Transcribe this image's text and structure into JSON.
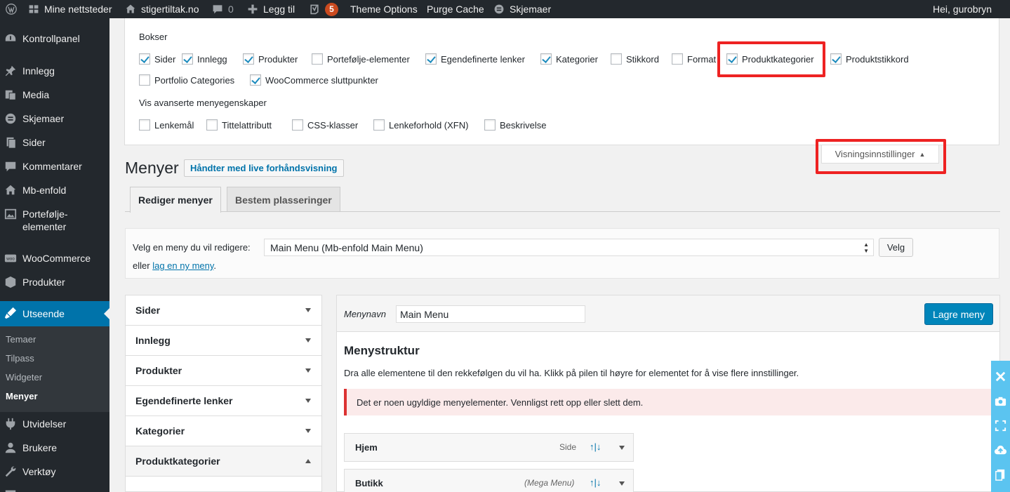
{
  "adminbar": {
    "my_sites": "Mine nettsteder",
    "site": "stigertiltak.no",
    "comments": "0",
    "new": "Legg til",
    "yoast_count": "5",
    "theme_options": "Theme Options",
    "purge_cache": "Purge Cache",
    "forms": "Skjemaer",
    "greeting": "Hei, gurobryn"
  },
  "sidebar": {
    "items": [
      {
        "label": "Kontrollpanel",
        "icon": "dashboard-icon"
      },
      {
        "label": "Innlegg",
        "icon": "pin-icon"
      },
      {
        "label": "Media",
        "icon": "media-icon"
      },
      {
        "label": "Skjemaer",
        "icon": "forms-icon"
      },
      {
        "label": "Sider",
        "icon": "pages-icon"
      },
      {
        "label": "Kommentarer",
        "icon": "comment-icon"
      },
      {
        "label": "Mb-enfold",
        "icon": "home-icon"
      },
      {
        "label": "Portefølje-elementer",
        "icon": "portfolio-icon"
      },
      {
        "label": "WooCommerce",
        "icon": "woo-icon"
      },
      {
        "label": "Produkter",
        "icon": "products-icon"
      },
      {
        "label": "Utseende",
        "icon": "appearance-icon"
      },
      {
        "label": "Utvidelser",
        "icon": "plugins-icon"
      },
      {
        "label": "Brukere",
        "icon": "users-icon"
      },
      {
        "label": "Verktøy",
        "icon": "tools-icon"
      }
    ],
    "sub": [
      "Temaer",
      "Tilpass",
      "Widgeter",
      "Menyer"
    ]
  },
  "screen_options": {
    "boxes_title": "Bokser",
    "boxes": [
      {
        "label": "Sider",
        "checked": true
      },
      {
        "label": "Innlegg",
        "checked": true
      },
      {
        "label": "Produkter",
        "checked": true
      },
      {
        "label": "Portefølje-elementer",
        "checked": false
      },
      {
        "label": "Egendefinerte lenker",
        "checked": true
      },
      {
        "label": "Kategorier",
        "checked": true
      },
      {
        "label": "Stikkord",
        "checked": false
      },
      {
        "label": "Format",
        "checked": false
      },
      {
        "label": "Produktkategorier",
        "checked": true
      },
      {
        "label": "Produktstikkord",
        "checked": true
      },
      {
        "label": "Portfolio Categories",
        "checked": false
      },
      {
        "label": "WooCommerce sluttpunkter",
        "checked": true
      }
    ],
    "advanced_title": "Vis avanserte menyegenskaper",
    "advanced": [
      {
        "label": "Lenkemål",
        "checked": false
      },
      {
        "label": "Tittelattributt",
        "checked": false
      },
      {
        "label": "CSS-klasser",
        "checked": false
      },
      {
        "label": "Lenkeforhold (XFN)",
        "checked": false
      },
      {
        "label": "Beskrivelse",
        "checked": false
      }
    ],
    "toggle_label": "Visningsinnstillinger"
  },
  "page": {
    "title": "Menyer",
    "live_button": "Håndter med live forhåndsvisning",
    "tabs": [
      "Rediger menyer",
      "Bestem plasseringer"
    ]
  },
  "manage": {
    "label": "Velg en meny du vil redigere:",
    "selected": "Main Menu (Mb-enfold Main Menu)",
    "select_button": "Velg",
    "or_text": "eller",
    "create_link": "lag en ny meny",
    "period": "."
  },
  "accordion": [
    "Sider",
    "Innlegg",
    "Produkter",
    "Egendefinerte lenker",
    "Kategorier",
    "Produktkategorier"
  ],
  "editor": {
    "name_label": "Menynavn",
    "name_value": "Main Menu",
    "save_button": "Lagre meny",
    "structure_title": "Menystruktur",
    "structure_desc": "Dra alle elementene til den rekkefølgen du vil ha. Klikk på pilen til høyre for elementet for å vise flere innstillinger.",
    "error": "Det er noen ugyldige menyelementer. Vennligst rett opp eller slett dem.",
    "items": [
      {
        "title": "Hjem",
        "type": "Side",
        "updown": "↑|↓"
      },
      {
        "title": "Butikk",
        "type": "(Mega Menu)",
        "updown": "↑|↓"
      }
    ]
  },
  "colors": {
    "accent": "#0073aa",
    "highlight_box": "#ee2222",
    "save": "#0085ba",
    "error": "#dc3232"
  }
}
